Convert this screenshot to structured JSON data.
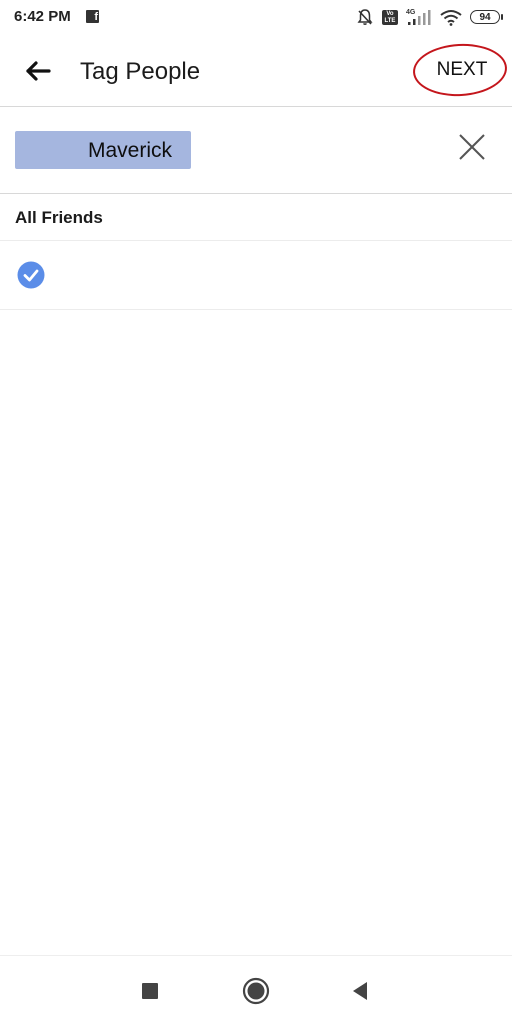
{
  "status_bar": {
    "time": "6:42 PM",
    "notification_icon": "facebook-icon",
    "network": "4G",
    "volte_label": "Vo LTE",
    "battery": "94"
  },
  "header": {
    "title": "Tag People",
    "back_icon": "arrow-left-icon",
    "next_label": "NEXT",
    "annotation_color": "#c4161c"
  },
  "tag_input": {
    "selected_tags": [
      "Maverick"
    ],
    "clear_icon": "close-icon",
    "chip_color": "#a5b6df"
  },
  "friends_section": {
    "title": "All Friends",
    "items": [
      {
        "name": "",
        "checked": true
      }
    ],
    "check_color": "#5b8de8"
  },
  "nav_bar": {
    "buttons": [
      "recent-apps-icon",
      "home-icon",
      "back-icon"
    ]
  }
}
